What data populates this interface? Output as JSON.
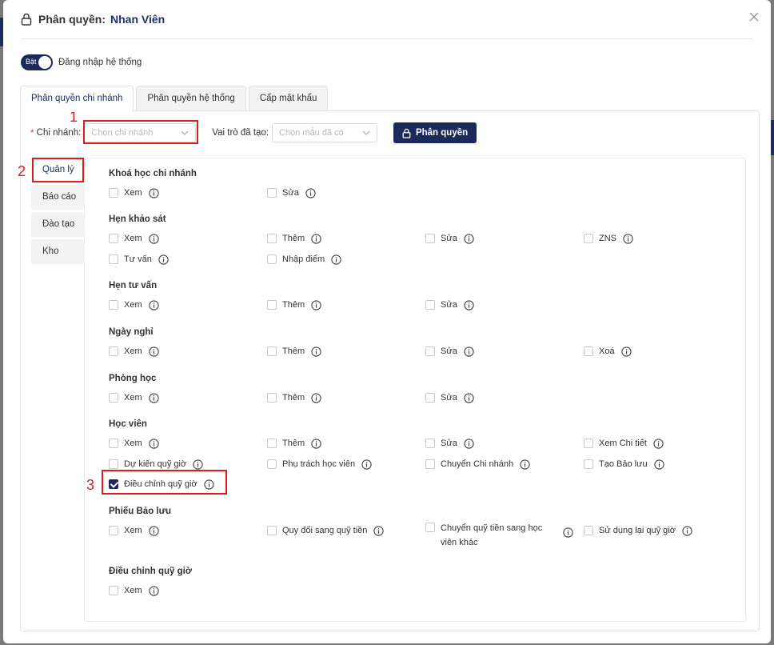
{
  "modal": {
    "title_label": "Phân quyền:",
    "title_name": "Nhan Viên"
  },
  "login_toggle": {
    "state_label": "Bật",
    "text": "Đăng nhập hệ thống"
  },
  "tabs": [
    {
      "label": "Phân quyền chi nhánh",
      "active": true
    },
    {
      "label": "Phân quyền hệ thống",
      "active": false
    },
    {
      "label": "Cấp mật khẩu",
      "active": false
    }
  ],
  "filter": {
    "required_mark": "*",
    "branch_label": "Chi nhánh:",
    "branch_placeholder": "Chọn chi nhánh",
    "role_label": "Vai trò đã tạo:",
    "role_placeholder": "Chọn mẫu đã có",
    "assign_button": "Phân quyền"
  },
  "annotations": [
    "1",
    "2",
    "3"
  ],
  "sidebar": [
    {
      "label": "Quản lý",
      "active": true
    },
    {
      "label": "Báo cáo",
      "active": false
    },
    {
      "label": "Đào tạo",
      "active": false
    },
    {
      "label": "Kho",
      "active": false
    }
  ],
  "groups": [
    {
      "title": "Khoá học chi nhánh",
      "perms": [
        {
          "label": "Xem",
          "checked": false
        },
        {
          "label": "Sửa",
          "checked": false
        }
      ]
    },
    {
      "title": "Hẹn khảo sát",
      "perms": [
        {
          "label": "Xem",
          "checked": false
        },
        {
          "label": "Thêm",
          "checked": false
        },
        {
          "label": "Sửa",
          "checked": false
        },
        {
          "label": "ZNS",
          "checked": false
        },
        {
          "label": "Tư vấn",
          "checked": false
        },
        {
          "label": "Nhập điểm",
          "checked": false
        }
      ]
    },
    {
      "title": "Hẹn tư vấn",
      "perms": [
        {
          "label": "Xem",
          "checked": false
        },
        {
          "label": "Thêm",
          "checked": false
        },
        {
          "label": "Sửa",
          "checked": false
        }
      ]
    },
    {
      "title": "Ngày nghỉ",
      "perms": [
        {
          "label": "Xem",
          "checked": false
        },
        {
          "label": "Thêm",
          "checked": false
        },
        {
          "label": "Sửa",
          "checked": false
        },
        {
          "label": "Xoá",
          "checked": false
        }
      ]
    },
    {
      "title": "Phòng học",
      "perms": [
        {
          "label": "Xem",
          "checked": false
        },
        {
          "label": "Thêm",
          "checked": false
        },
        {
          "label": "Sửa",
          "checked": false
        }
      ]
    },
    {
      "title": "Học viên",
      "perms": [
        {
          "label": "Xem",
          "checked": false
        },
        {
          "label": "Thêm",
          "checked": false
        },
        {
          "label": "Sửa",
          "checked": false
        },
        {
          "label": "Xem Chi tiết",
          "checked": false
        },
        {
          "label": "Dự kiến quỹ giờ",
          "checked": false
        },
        {
          "label": "Phụ trách học viên",
          "checked": false
        },
        {
          "label": "Chuyển Chi nhánh",
          "checked": false
        },
        {
          "label": "Tạo Bảo lưu",
          "checked": false
        },
        {
          "label": "Điều chỉnh quỹ giờ",
          "checked": true
        }
      ]
    },
    {
      "title": "Phiếu Bảo lưu",
      "perms": [
        {
          "label": "Xem",
          "checked": false
        },
        {
          "label": "Quy đổi sang quỹ tiền",
          "checked": false
        },
        {
          "label": "Chuyển quỹ tiền sang học viên khác",
          "checked": false
        },
        {
          "label": "Sử dụng lại quỹ giờ",
          "checked": false
        }
      ]
    },
    {
      "title": "Điều chỉnh quỹ giờ",
      "perms": [
        {
          "label": "Xem",
          "checked": false
        }
      ]
    }
  ]
}
